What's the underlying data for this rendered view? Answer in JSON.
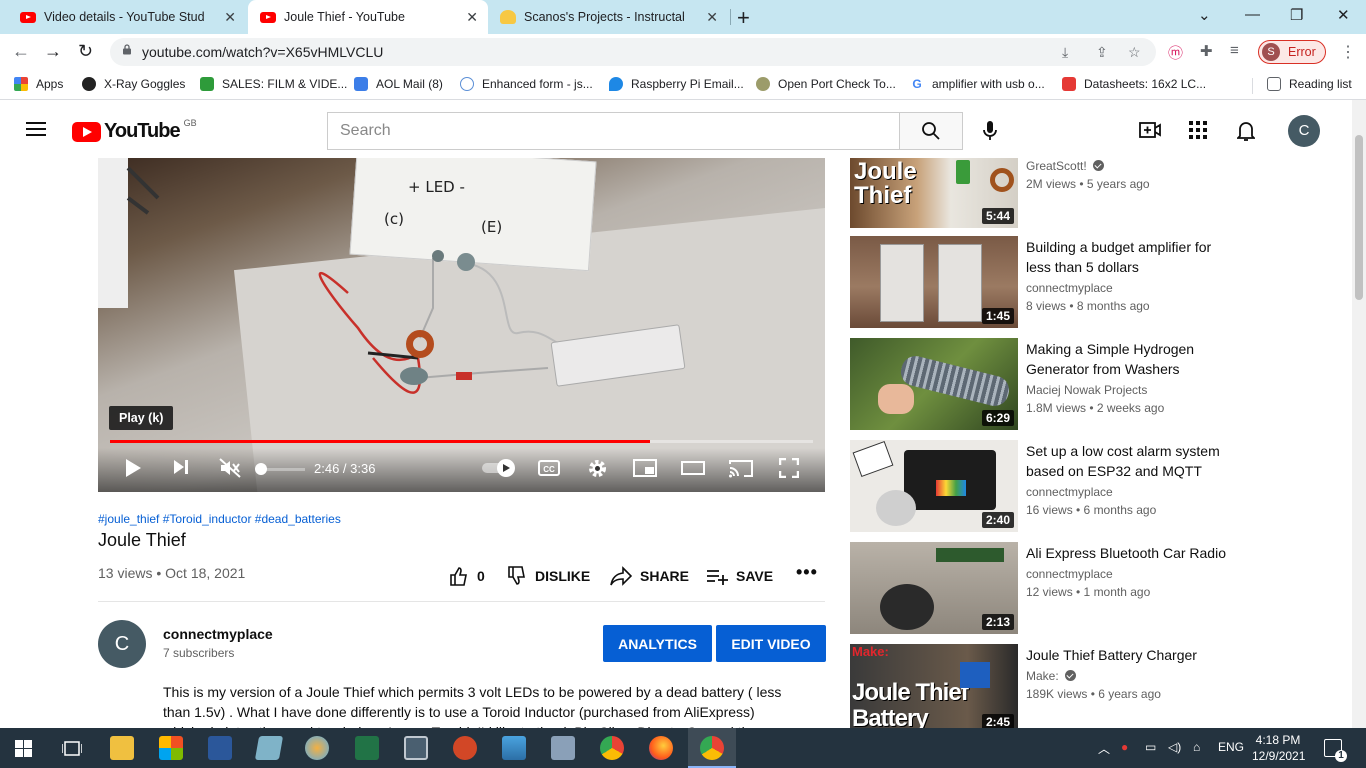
{
  "browser": {
    "tabs": [
      {
        "title": "Video details - YouTube Studio",
        "close": "✕"
      },
      {
        "title": "Joule Thief - YouTube",
        "close": "✕"
      },
      {
        "title": "Scanos's Projects - Instructables",
        "close": "✕"
      }
    ],
    "new_tab": "+",
    "url": "youtube.com/watch?v=X65vHMLVCLU",
    "profile_initial": "S",
    "profile_status": "Error",
    "bookmarks": [
      "Apps",
      "X-Ray Goggles",
      "SALES: FILM & VIDE...",
      "AOL Mail (8)",
      "Enhanced form - js...",
      "Raspberry Pi Email...",
      "Open Port Check To...",
      "amplifier with usb o...",
      "Datasheets: 16x2 LC..."
    ],
    "reading_list": "Reading list"
  },
  "youtube": {
    "logo_text": "YouTube",
    "country": "GB",
    "search_placeholder": "Search",
    "user_initial": "C"
  },
  "player": {
    "tooltip": "Play (k)",
    "time": "2:46 / 3:36",
    "progress": 0.768,
    "handwriting": {
      "plus_led": "+ LED -",
      "c": "(c)",
      "e": "(E)"
    }
  },
  "video": {
    "tags": "#joule_thief #Toroid_inductor #dead_batteries",
    "title": "Joule Thief",
    "meta": "13 views • Oct 18, 2021",
    "likes": "0",
    "dislike": "DISLIKE",
    "share": "SHARE",
    "save": "SAVE",
    "channel_initial": "C",
    "channel": "connectmyplace",
    "subscribers": "7 subscribers",
    "analytics": "ANALYTICS",
    "edit_video": "EDIT VIDEO",
    "description": "This is my version of a Joule Thief which permits 3 volt LEDs to be powered by a dead battery ( less than 1.5v) . What I have done differently is to use a Toroid Inductor (purchased from AliExpress) which obviates the need to wind one's own Toroid. I'd like to thank Big Clive, DirectorOrr and the"
  },
  "recommendations": [
    {
      "title": "",
      "channel": "GreatScott!",
      "verified": true,
      "stats": "2M views • 5 years ago",
      "duration": "5:44",
      "thumb_text": "Joule Thief"
    },
    {
      "title": "Building a budget amplifier for less than 5 dollars",
      "channel": "connectmyplace",
      "verified": false,
      "stats": "8 views • 8 months ago",
      "duration": "1:45"
    },
    {
      "title": "Making a Simple Hydrogen Generator from Washers",
      "channel": "Maciej Nowak Projects",
      "verified": false,
      "stats": "1.8M views • 2 weeks ago",
      "duration": "6:29"
    },
    {
      "title": "Set up a low cost alarm system based on ESP32 and MQTT",
      "channel": "connectmyplace",
      "verified": false,
      "stats": "16 views • 6 months ago",
      "duration": "2:40"
    },
    {
      "title": "Ali Express Bluetooth Car Radio",
      "channel": "connectmyplace",
      "verified": false,
      "stats": "12 views • 1 month ago",
      "duration": "2:13"
    },
    {
      "title": "Joule Thief Battery Charger",
      "channel": "Make:",
      "verified": true,
      "stats": "189K views • 6 years ago",
      "duration": "2:45",
      "thumb_text": "Joule Thief Battery Charge",
      "thumb_brand": "Make:"
    }
  ],
  "taskbar": {
    "language": "ENG",
    "time": "4:18 PM",
    "date": "12/9/2021",
    "notifications": "1"
  },
  "colors": {
    "accent_red": "#ff0000",
    "link_blue": "#065fd4",
    "taskbar": "#24333f",
    "tabstrip": "#c6e6f1"
  }
}
